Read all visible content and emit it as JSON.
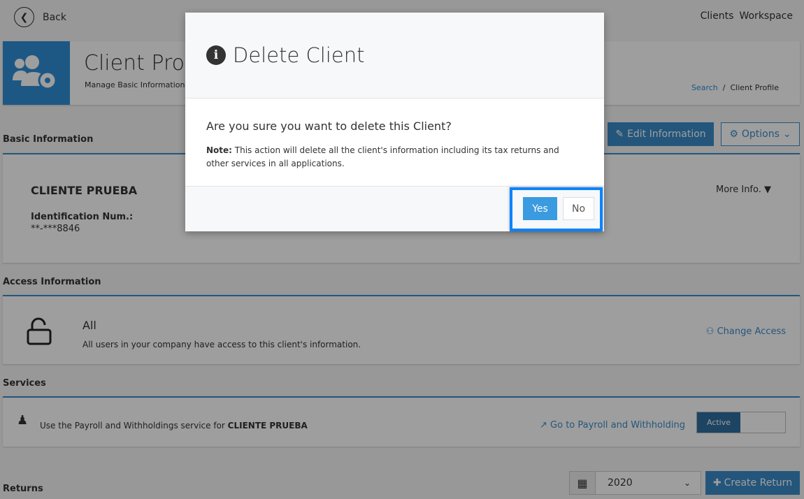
{
  "topbar": {
    "back": "Back",
    "nav": [
      "Clients",
      "Workspace"
    ]
  },
  "header": {
    "title": "Client Profile",
    "subtitle": "Manage Basic Information, T",
    "breadcrumb": [
      "Search",
      "Client Profile"
    ]
  },
  "basic": {
    "section": "Basic Information",
    "edit": "Edit Information",
    "options": "Options",
    "client_name": "CLIENTE PRUEBA",
    "id_label": "Identification Num.:",
    "id_value": "**-***8846",
    "more": "More Info."
  },
  "access": {
    "section": "Access Information",
    "title": "All",
    "desc": "All users in your company have access to this client's information.",
    "change": "Change Access"
  },
  "services": {
    "section": "Services",
    "text": "Use the Payroll and Withholdings service for ",
    "client": "CLIENTE PRUEBA",
    "link": "Go to Payroll and Withholding",
    "toggle": "Active"
  },
  "returns": {
    "section": "Returns",
    "year": "2020",
    "create": "Create Return"
  },
  "modal": {
    "title": "Delete Client",
    "question": "Are you sure you want to delete this Client?",
    "note_label": "Note:",
    "note": " This action will delete all the client's information including its tax returns and other services in all applications.",
    "yes": "Yes",
    "no": "No"
  }
}
